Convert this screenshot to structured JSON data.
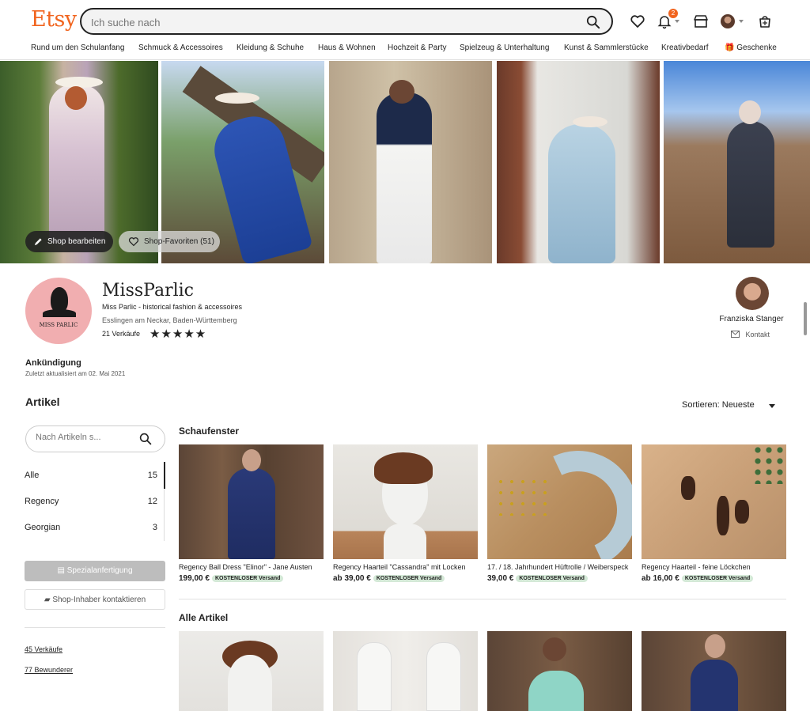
{
  "header": {
    "logo": "Etsy",
    "search_placeholder": "Ich suche nach",
    "notification_count": "2",
    "icons": [
      "search-icon",
      "heart-icon",
      "bell-icon",
      "shop-icon",
      "avatar",
      "cart-icon"
    ]
  },
  "nav": {
    "items": [
      "Rund um den Schulanfang",
      "Schmuck & Accessoires",
      "Kleidung & Schuhe",
      "Haus & Wohnen",
      "Hochzeit & Party",
      "Spielzeug & Unterhaltung",
      "Kunst & Sammlerstücke",
      "Kreativbedarf",
      "Geschenke"
    ]
  },
  "banner": {
    "edit_label": "Shop bearbeiten",
    "fav_label": "Shop-Favoriten (51)"
  },
  "shop": {
    "name": "MissParlic",
    "subtitle": "Miss Parlic - historical fashion & accessoires",
    "location": "Esslingen am Neckar, Baden-Württemberg",
    "sales": "21 Verkäufe",
    "rating": 5,
    "stars": "★★★★★",
    "logo_text": "MISS PARLIC"
  },
  "owner": {
    "name": "Franziska Stanger",
    "contact_label": "Kontakt"
  },
  "announcement": {
    "title": "Ankündigung",
    "updated": "Zuletzt aktualisiert am 02. Mai 2021"
  },
  "artikel": {
    "title": "Artikel",
    "sort_label": "Sortieren: Neueste",
    "search_placeholder": "Nach Artikeln s...",
    "categories": [
      {
        "label": "Alle",
        "count": "15"
      },
      {
        "label": "Regency",
        "count": "12"
      },
      {
        "label": "Georgian",
        "count": "3"
      }
    ],
    "custom_btn": "Spezialanfertigung",
    "contact_btn": "Shop-Inhaber kontaktieren",
    "sales_link": "45 Verkäufe",
    "fans_link": "77 Bewunderer"
  },
  "showcase": {
    "title": "Schaufenster",
    "items": [
      {
        "title": "Regency Ball Dress \"Elinor\" - Jane Austen",
        "price": "199,00 €",
        "ship": "KOSTENLOSER Versand"
      },
      {
        "title": "Regency Haarteil \"Cassandra\" mit Locken",
        "price": "ab 39,00 €",
        "ship": "KOSTENLOSER Versand"
      },
      {
        "title": "17. / 18. Jahrhundert Hüftrolle / Weiberspeck",
        "price": "39,00 €",
        "ship": "KOSTENLOSER Versand"
      },
      {
        "title": "Regency Haarteil - feine Löckchen",
        "price": "ab 16,00 €",
        "ship": "KOSTENLOSER Versand"
      }
    ]
  },
  "all_items": {
    "title": "Alle Artikel"
  },
  "colors": {
    "brand": "#f1641e",
    "shipping_badge": "#d4e9d7",
    "shop_logo_bg": "#f1aeb0"
  }
}
